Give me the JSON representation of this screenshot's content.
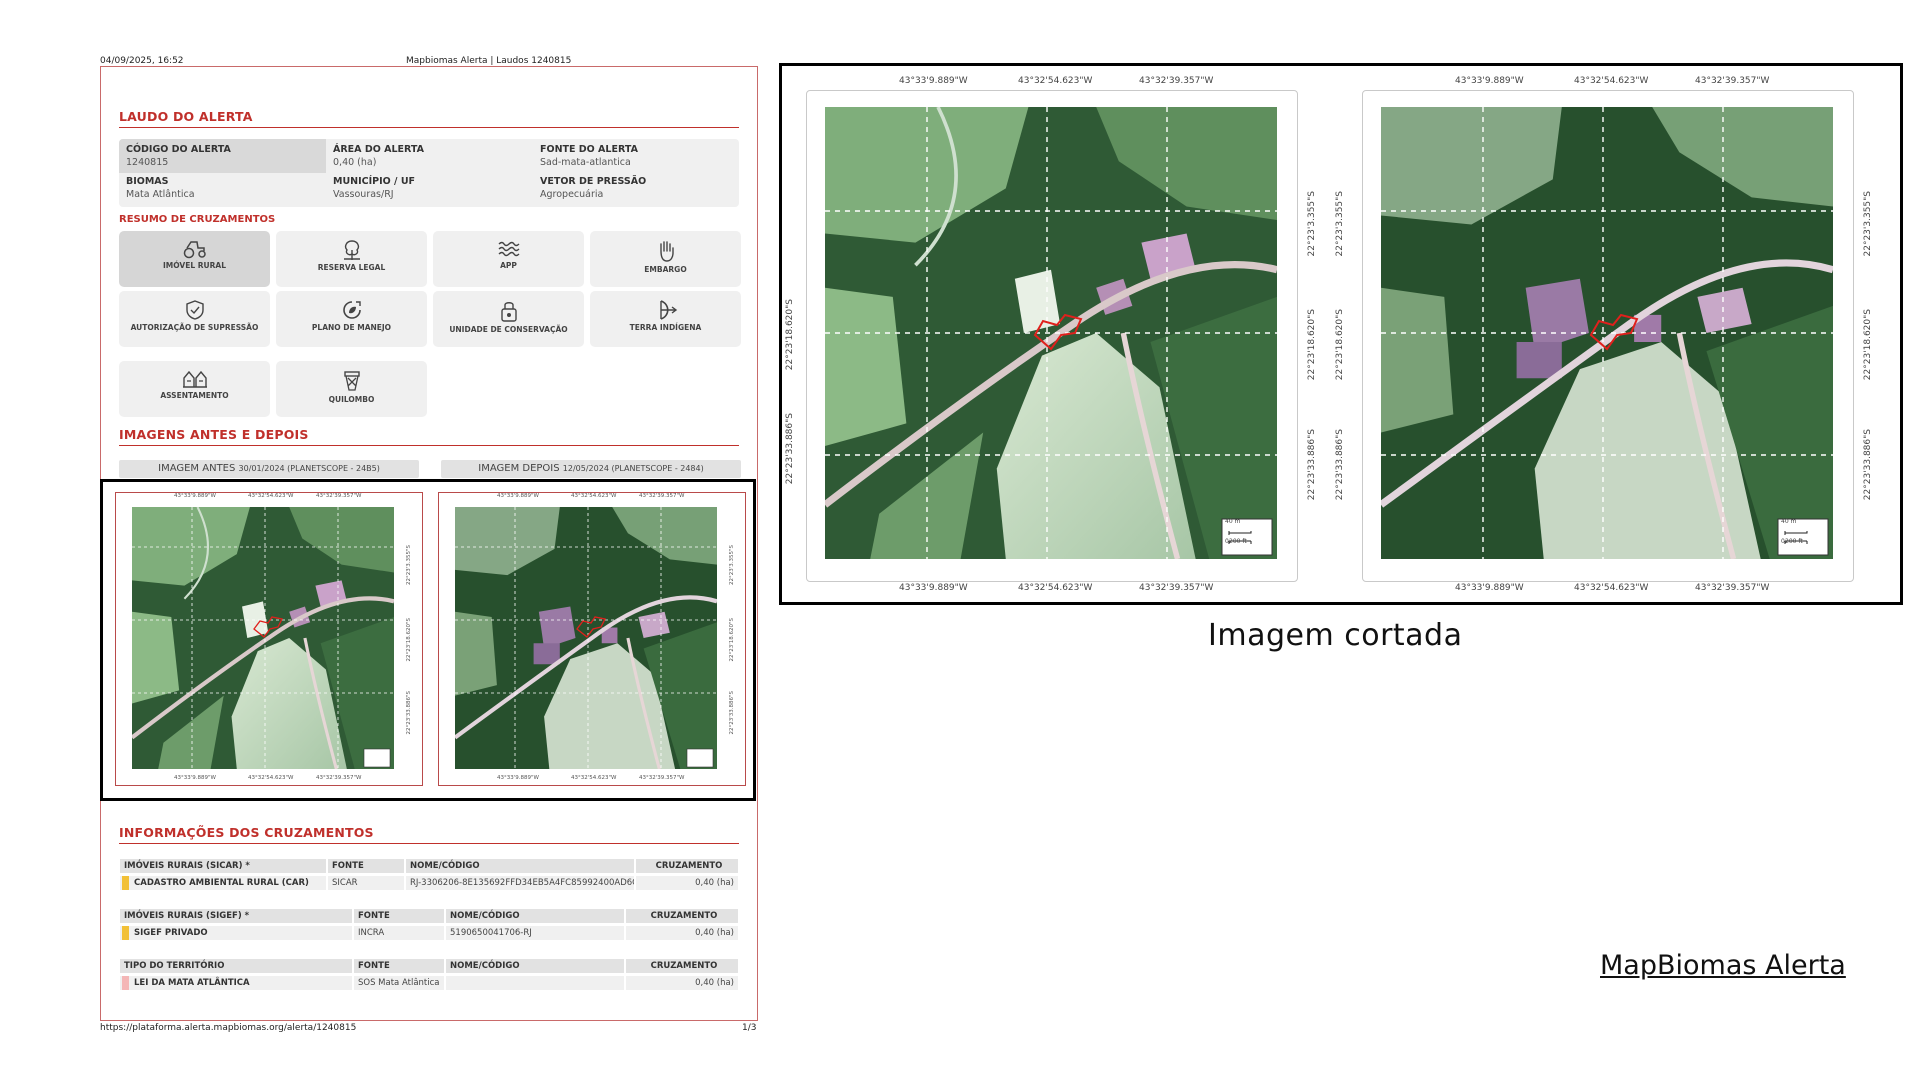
{
  "print_header": {
    "datetime": "04/09/2025, 16:52",
    "doc_title": "Mapbiomas Alerta | Laudos 1240815"
  },
  "print_footer": {
    "url": "https://plataforma.alerta.mapbiomas.org/alerta/1240815",
    "page": "1/3"
  },
  "laudo": {
    "title": "LAUDO DO ALERTA",
    "fields": [
      {
        "label": "CÓDIGO DO ALERTA",
        "value": "1240815"
      },
      {
        "label": "ÁREA DO ALERTA",
        "value": "0,40 (ha)"
      },
      {
        "label": "FONTE DO ALERTA",
        "value": "Sad-mata-atlantica"
      },
      {
        "label": "BIOMAS",
        "value": "Mata Atlântica"
      },
      {
        "label": "MUNICÍPIO / UF",
        "value": "Vassouras/RJ"
      },
      {
        "label": "VETOR DE PRESSÃO",
        "value": "Agropecuária"
      }
    ]
  },
  "resumo": {
    "title": "RESUMO DE CRUZAMENTOS",
    "tiles": [
      {
        "label": "IMÓVEL RURAL",
        "icon": "tractor-icon"
      },
      {
        "label": "RESERVA LEGAL",
        "icon": "tree-icon"
      },
      {
        "label": "APP",
        "icon": "water-waves-icon"
      },
      {
        "label": "EMBARGO",
        "icon": "hand-stop-icon"
      },
      {
        "label": "AUTORIZAÇÃO DE SUPRESSÃO",
        "icon": "shield-check-icon"
      },
      {
        "label": "PLANO DE MANEJO",
        "icon": "recycle-leaf-icon"
      },
      {
        "label": "UNIDADE DE CONSERVAÇÃO",
        "icon": "lock-icon"
      },
      {
        "label": "TERRA INDÍGENA",
        "icon": "bow-arrow-icon"
      },
      {
        "label": "ASSENTAMENTO",
        "icon": "houses-icon"
      },
      {
        "label": "QUILOMBO",
        "icon": "drum-icon"
      }
    ]
  },
  "imagens": {
    "title": "IMAGENS ANTES E DEPOIS",
    "antes_label": "IMAGEM ANTES",
    "antes_info": "30/01/2024 (PLANETSCOPE - 24B5)",
    "depois_label": "IMAGEM DEPOIS",
    "depois_info": "12/05/2024 (PLANETSCOPE - 2484)"
  },
  "map_coords": {
    "lon": [
      "43°33'9.889\"W",
      "43°32'54.623\"W",
      "43°32'39.357\"W"
    ],
    "lat": [
      "22°23'3.355\"S",
      "22°23'18.620\"S",
      "22°23'33.886\"S"
    ],
    "scale_m": "40 m",
    "scale_ft": "200 ft",
    "scale_zero": "0"
  },
  "cruzamentos": {
    "title": "INFORMAÇÕES DOS CRUZAMENTOS",
    "tables": [
      {
        "headers": [
          "IMÓVEIS RURAIS (SICAR) *",
          "FONTE",
          "NOME/CÓDIGO",
          "CRUZAMENTO"
        ],
        "row": [
          "CADASTRO AMBIENTAL RURAL (CAR)",
          "SICAR",
          "RJ-3306206-8E135692FFD34EB5A4FC85992400AD6C",
          "0,40 (ha)"
        ],
        "swatch": "#f2c037"
      },
      {
        "headers": [
          "IMÓVEIS RURAIS (SIGEF) *",
          "FONTE",
          "NOME/CÓDIGO",
          "CRUZAMENTO"
        ],
        "row": [
          "SIGEF PRIVADO",
          "INCRA",
          "5190650041706-RJ",
          "0,40 (ha)"
        ],
        "swatch": "#f2c037"
      },
      {
        "headers": [
          "TIPO DO TERRITÓRIO",
          "FONTE",
          "NOME/CÓDIGO",
          "CRUZAMENTO"
        ],
        "row": [
          "LEI DA MATA ATLÂNTICA",
          "SOS Mata Atlântica",
          "",
          "0,40 (ha)"
        ],
        "swatch": "#f4b6b6"
      }
    ]
  },
  "caption": "Imagem cortada",
  "brand_link": "MapBiomas Alerta",
  "colors": {
    "accent": "#c0302b",
    "alert_polygon": "#e0201c"
  }
}
